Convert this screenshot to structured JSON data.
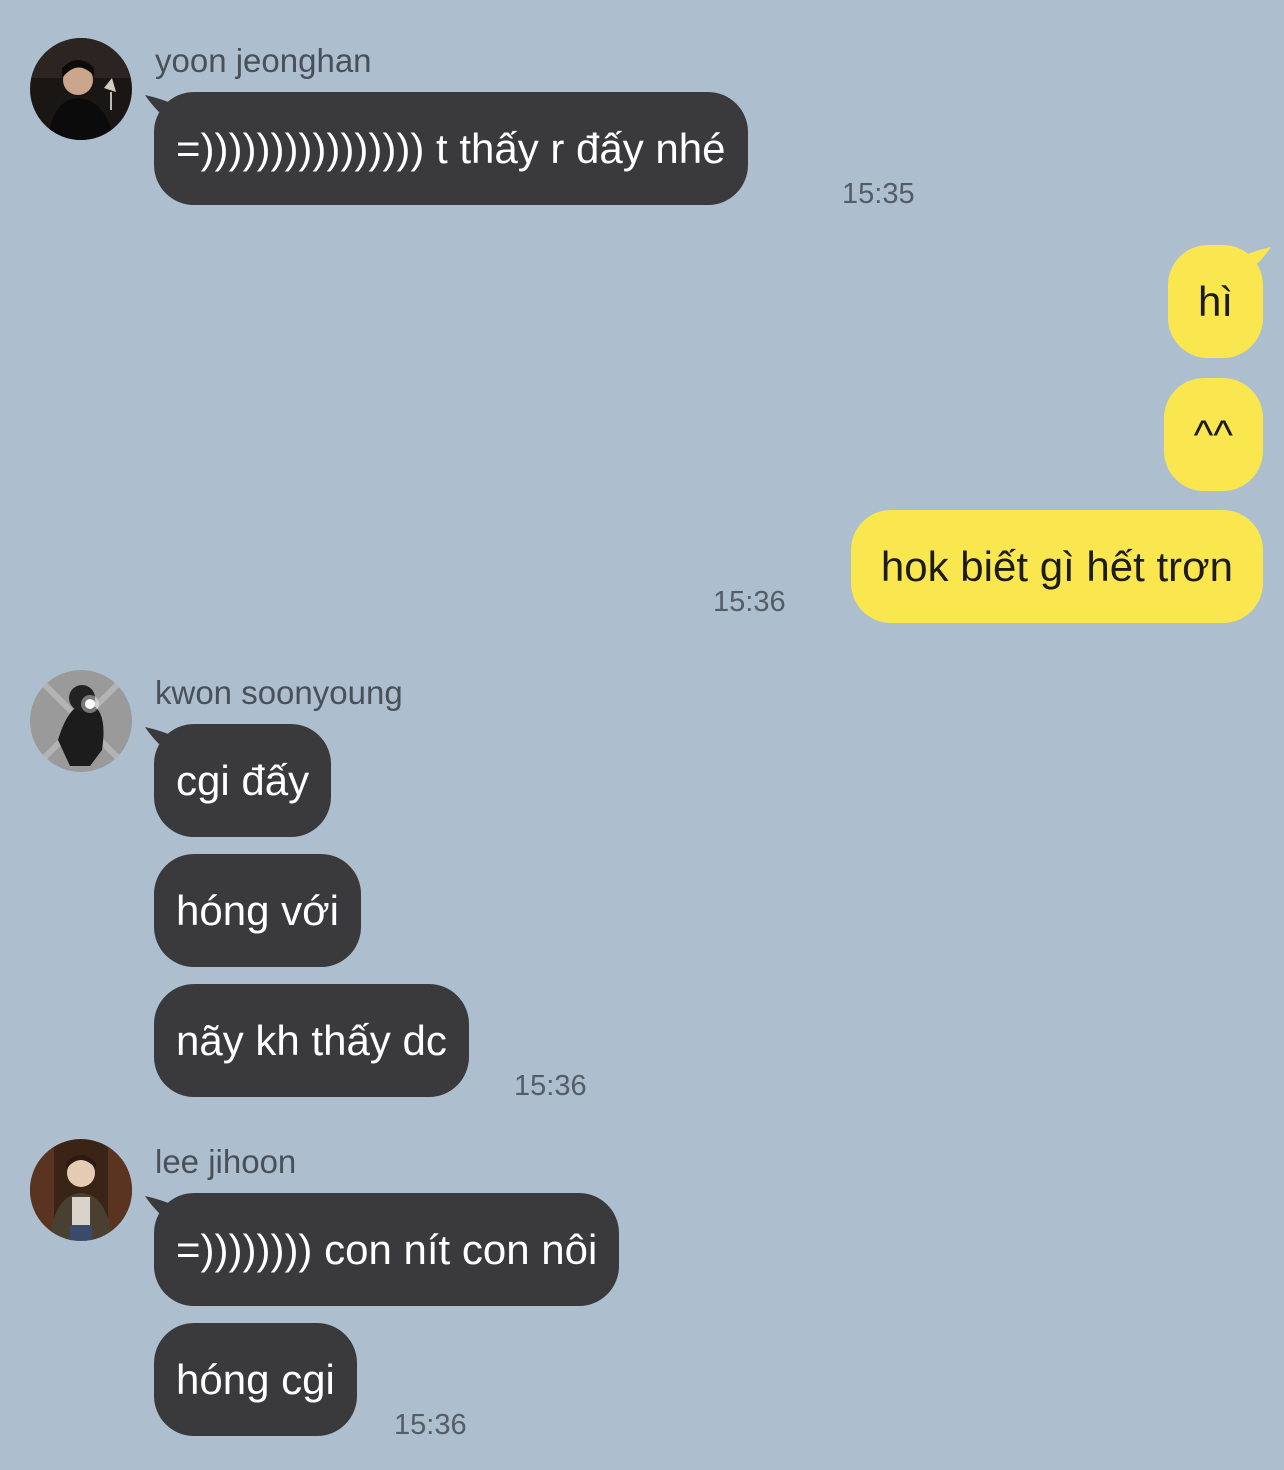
{
  "chat": {
    "colors": {
      "background": "#adbfcf",
      "incoming_bubble": "#3a3a3c",
      "outgoing_bubble": "#fae64f"
    },
    "groups": [
      {
        "sender": "yoon jeonghan",
        "avatar_icon": "profile-photo-yoon-jeonghan",
        "messages": [
          "=)))))))))))))))) t thấy r đấy nhé"
        ],
        "time": "15:35"
      },
      {
        "sender": "me",
        "messages": [
          "hì",
          "^^",
          "hok biết gì hết trơn"
        ],
        "time": "15:36"
      },
      {
        "sender": "kwon soonyoung",
        "avatar_icon": "profile-photo-kwon-soonyoung",
        "messages": [
          "cgi đấy",
          "hóng với",
          "nãy kh thấy dc"
        ],
        "time": "15:36"
      },
      {
        "sender": "lee jihoon",
        "avatar_icon": "profile-photo-lee-jihoon",
        "messages": [
          "=)))))))) con nít con nôi",
          "hóng cgi"
        ],
        "time": "15:36"
      }
    ]
  }
}
